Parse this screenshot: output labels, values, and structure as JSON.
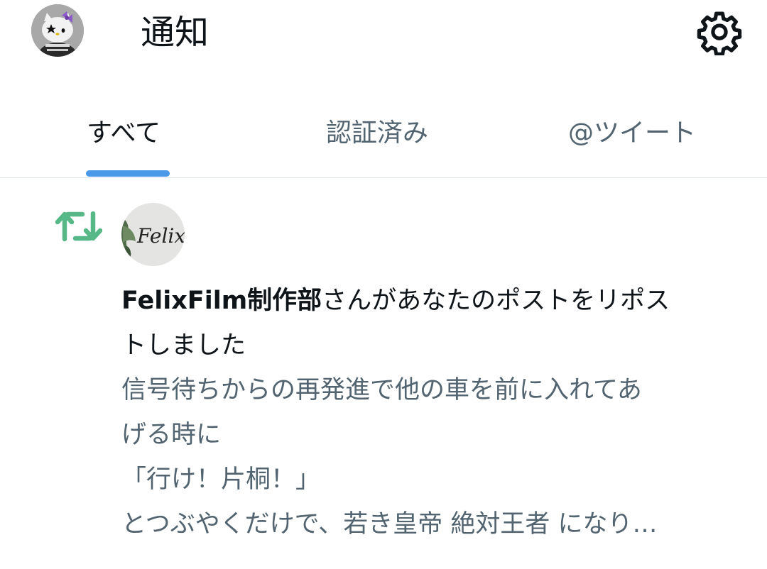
{
  "header": {
    "title": "通知",
    "avatar_icon": "user-avatar-kitty",
    "settings_icon": "gear-icon"
  },
  "tabs": [
    {
      "label": "すべて",
      "active": true
    },
    {
      "label": "認証済み",
      "active": false
    },
    {
      "label": "@ツイート",
      "active": false
    }
  ],
  "colors": {
    "accent": "#4a99e9",
    "retweet_green": "#56b886",
    "text_primary": "#0f1419",
    "text_secondary": "#536471",
    "divider": "#e1e8ed"
  },
  "notification": {
    "type_icon": "retweet-icon",
    "avatar_icon": "felix-avatar",
    "avatar_text": "Felix",
    "actor": "FelixFilm制作部",
    "action_line1": "さんがあなたのポストをリポス",
    "action_line2": "トしました",
    "post_lines": [
      "信号待ちからの再発進で他の車を前に入れてあ",
      "げる時に",
      "「行け！片桐！」",
      "とつぶやくだけで、若き皇帝 絶対王者 になり…"
    ]
  }
}
